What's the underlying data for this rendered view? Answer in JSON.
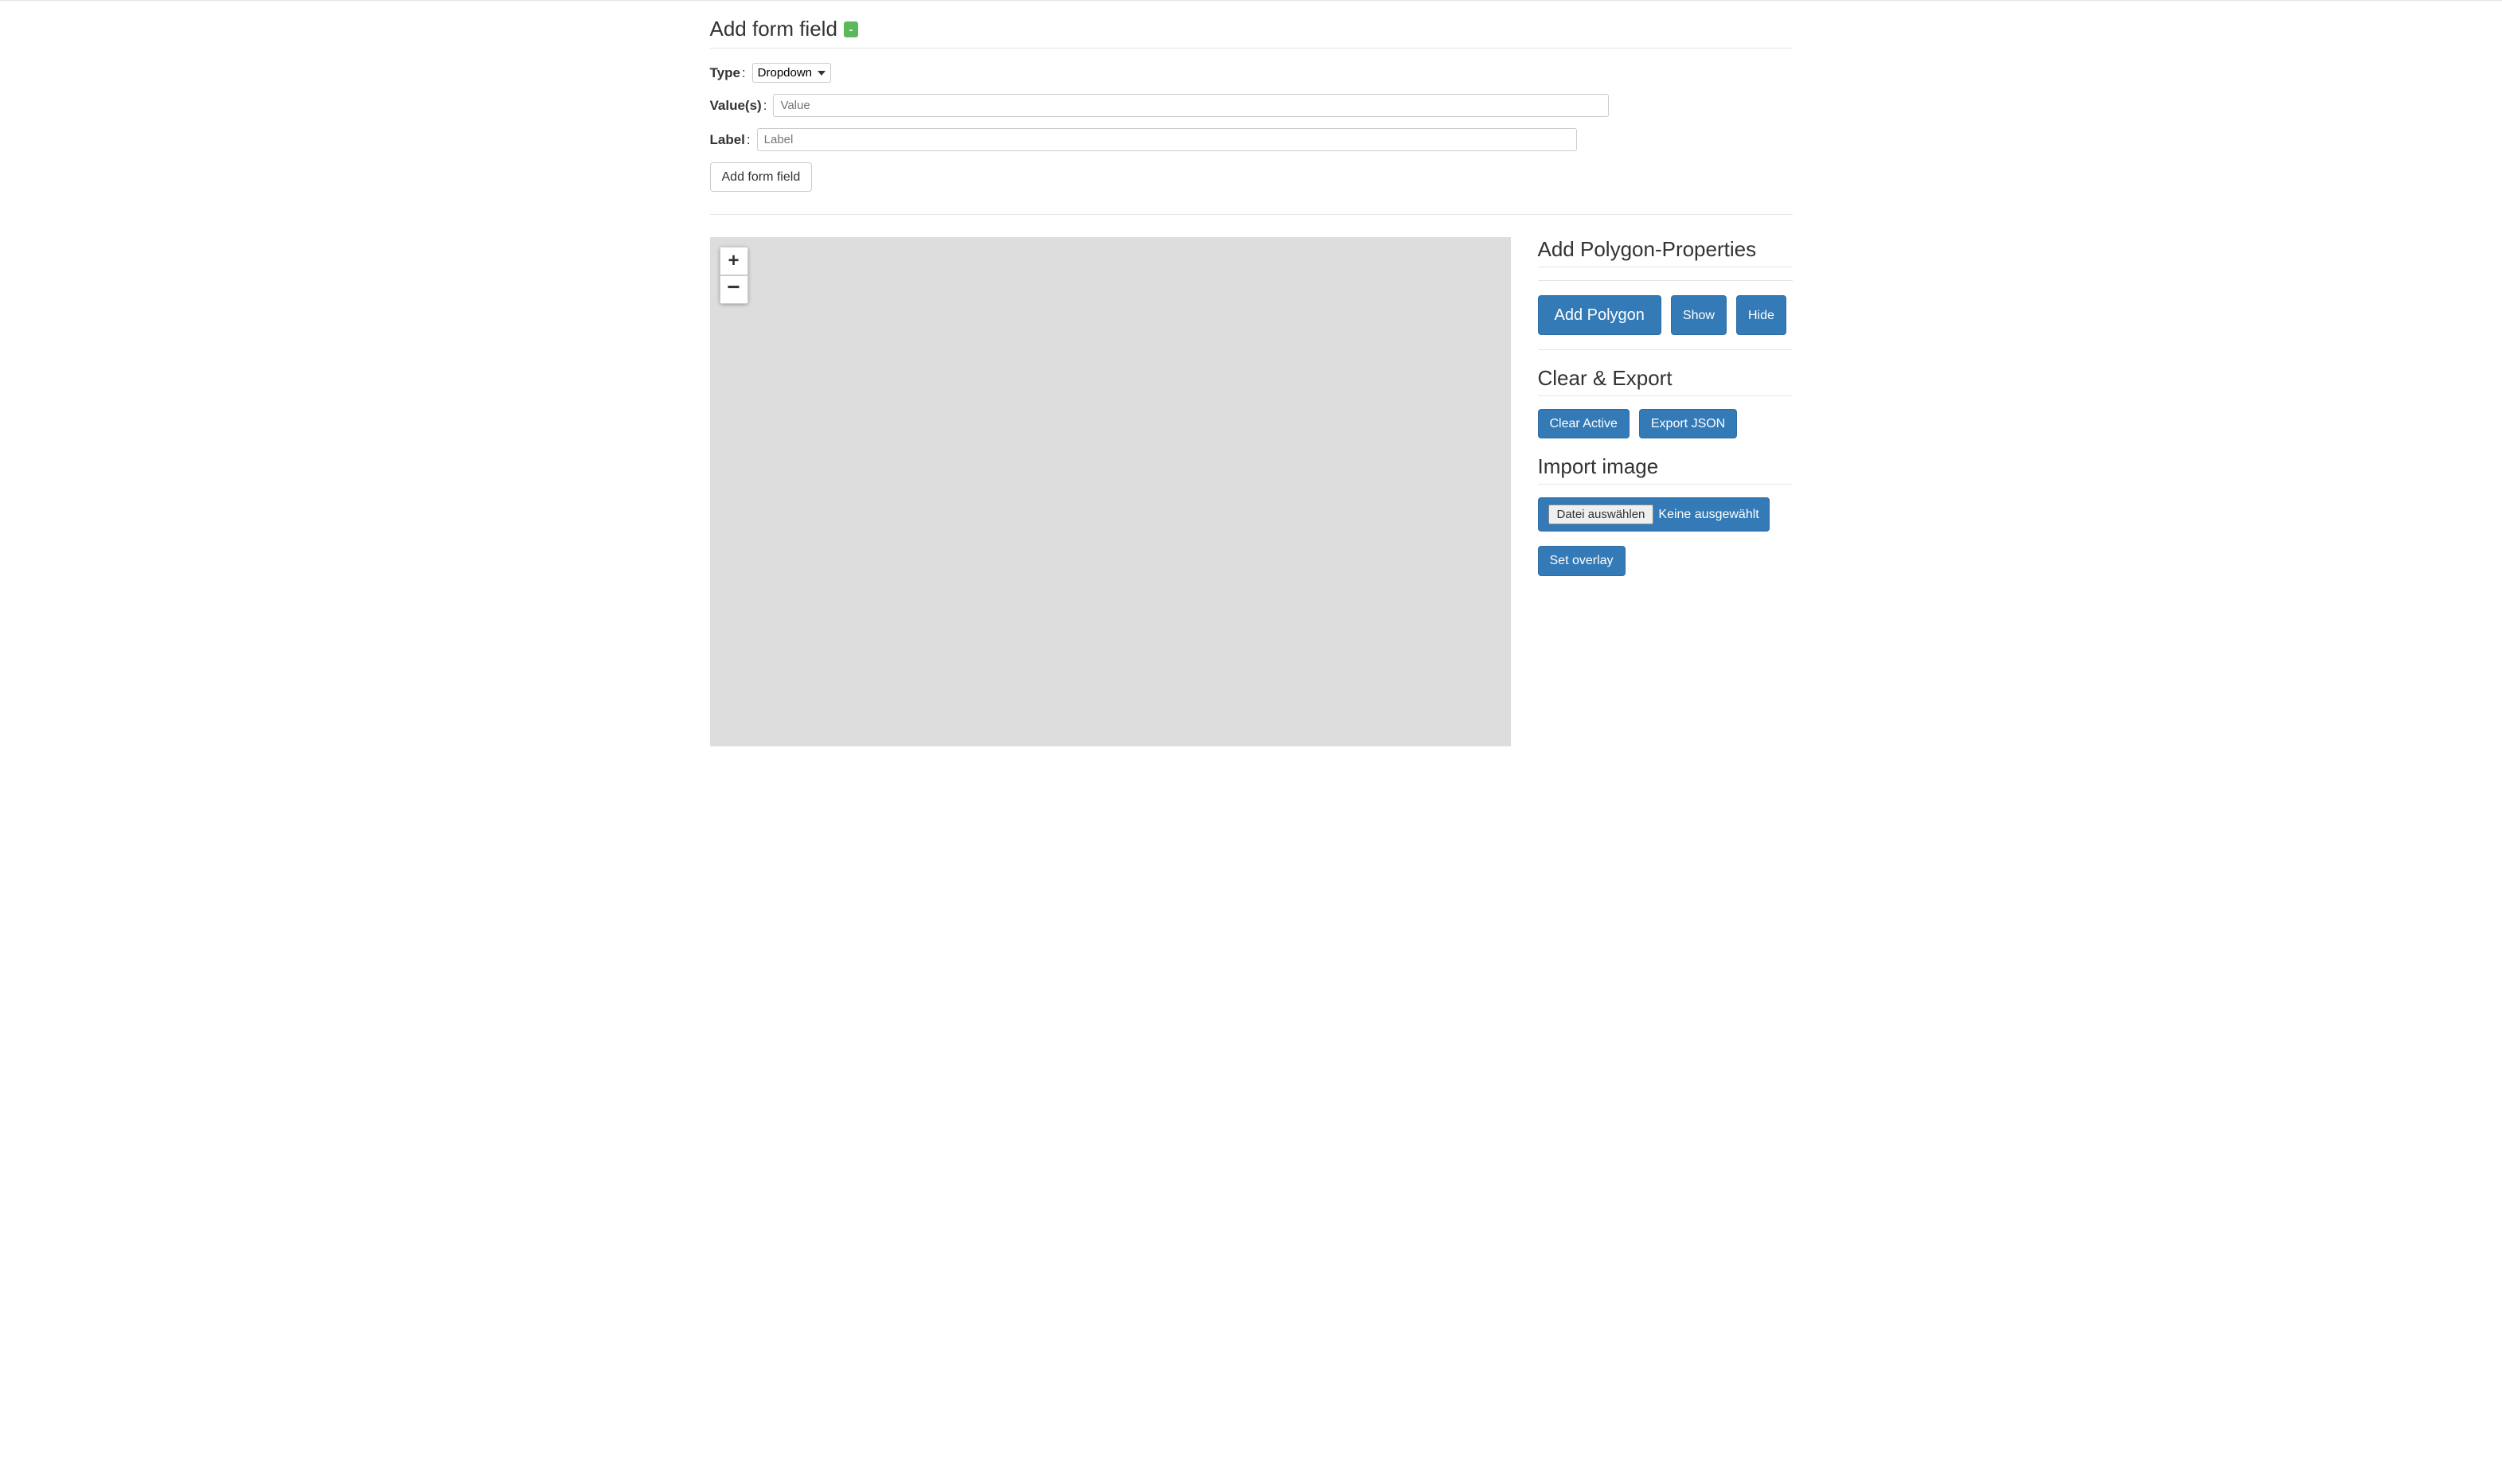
{
  "addFormField": {
    "heading": "Add form field",
    "collapse_badge": "-",
    "type_label": "Type",
    "type_selected": "Dropdown",
    "values_label": "Value(s)",
    "values_placeholder": "Value",
    "label_label": "Label",
    "label_placeholder": "Label",
    "submit_btn": "Add form field"
  },
  "map": {
    "zoom_in": "+",
    "zoom_out": "−"
  },
  "sidebar": {
    "polygon": {
      "heading": "Add Polygon-Properties",
      "add_btn": "Add Polygon",
      "show_btn": "Show",
      "hide_btn": "Hide"
    },
    "clearExport": {
      "heading": "Clear & Export",
      "clear_btn": "Clear Active",
      "export_btn": "Export JSON"
    },
    "importImage": {
      "heading": "Import image",
      "choose_file_btn": "Datei auswählen",
      "file_status": "Keine ausgewählt",
      "set_overlay_btn": "Set overlay"
    }
  }
}
